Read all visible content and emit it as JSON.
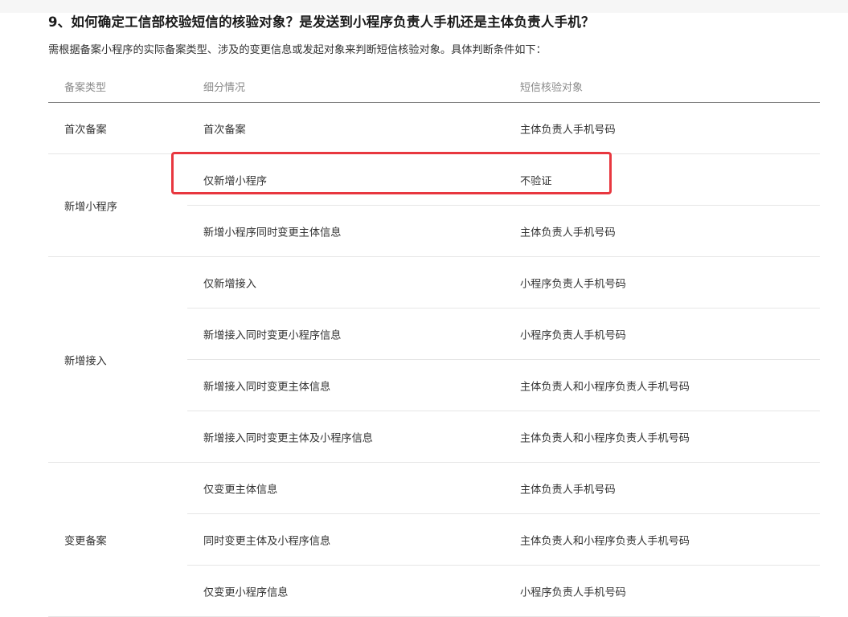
{
  "question": "9、如何确定工信部校验短信的核验对象？是发送到小程序负责人手机还是主体负责人手机？",
  "intro": "需根据备案小程序的实际备案类型、涉及的变更信息或发起对象来判断短信核验对象。具体判断条件如下：",
  "table": {
    "headers": [
      "备案类型",
      "细分情况",
      "短信核验对象"
    ],
    "groups": [
      {
        "type": "首次备案",
        "rows": [
          {
            "detail": "首次备案",
            "target": "主体负责人手机号码"
          }
        ]
      },
      {
        "type": "新增小程序",
        "rows": [
          {
            "detail": "仅新增小程序",
            "target": "不验证"
          },
          {
            "detail": "新增小程序同时变更主体信息",
            "target": "主体负责人手机号码"
          }
        ]
      },
      {
        "type": "新增接入",
        "rows": [
          {
            "detail": "仅新增接入",
            "target": "小程序负责人手机号码"
          },
          {
            "detail": "新增接入同时变更小程序信息",
            "target": "小程序负责人手机号码"
          },
          {
            "detail": "新增接入同时变更主体信息",
            "target": "主体负责人和小程序负责人手机号码"
          },
          {
            "detail": "新增接入同时变更主体及小程序信息",
            "target": "主体负责人和小程序负责人手机号码"
          }
        ]
      },
      {
        "type": "变更备案",
        "rows": [
          {
            "detail": "仅变更主体信息",
            "target": "主体负责人手机号码"
          },
          {
            "detail": "同时变更主体及小程序信息",
            "target": "主体负责人和小程序负责人手机号码"
          },
          {
            "detail": "仅变更小程序信息",
            "target": "小程序负责人手机号码"
          }
        ]
      }
    ]
  },
  "colors": {
    "highlight_border": "#e8373f",
    "header_text": "#8a8a8a",
    "header_rule": "#7a7a7a",
    "row_divider": "#e6e6e6"
  }
}
